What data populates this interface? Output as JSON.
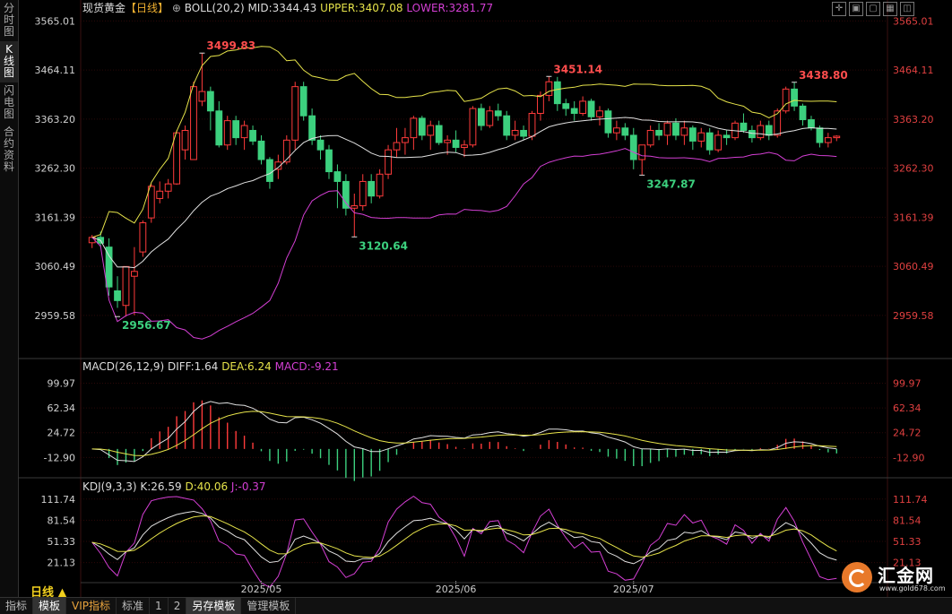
{
  "side_tabs": [
    "分时图",
    "K线图",
    "闪电图",
    "合约资料"
  ],
  "main": {
    "symbol": "现货黄金",
    "period": "【日线】",
    "plus": "⊕",
    "indicator": "BOLL(20,2)",
    "mid": "MID:3344.43",
    "upper": "UPPER:3407.08",
    "lower": "LOWER:3281.77"
  },
  "macd_header": {
    "name": "MACD(26,12,9)",
    "diff": "DIFF:1.64",
    "dea": "DEA:6.24",
    "macd": "MACD:-9.21"
  },
  "kdj_header": {
    "name": "KDJ(9,3,3)",
    "k": "K:26.59",
    "d": "D:40.06",
    "j": "J:-0.37"
  },
  "annotations": [
    "3499.83",
    "3451.14",
    "3438.80",
    "2956.67",
    "3120.64",
    "3247.87"
  ],
  "period_label": "日线 ▲",
  "bottom_tabs": [
    "指标",
    "模板",
    "VIP指标",
    "标准",
    "1",
    "2",
    "另存模板",
    "管理模板"
  ],
  "logo": {
    "text": "汇金网",
    "url": "www.gold678.com"
  },
  "window_icons": [
    "crosshair-icon",
    "zoom-in-icon",
    "zoom-out-icon",
    "grid-icon",
    "restore-icon"
  ],
  "colors": {
    "up": "#ff3b3b",
    "down": "#3cd07e",
    "mid": "#e0e0e0",
    "upper": "#e6e34a",
    "lower": "#d43fd4",
    "macd_diff": "#e0e0e0",
    "macd_dea": "#e6e34a",
    "kdj_k": "#e0e0e0",
    "kdj_d": "#e6e34a",
    "kdj_j": "#d43fd4",
    "ann_high": "#ff4d4d",
    "ann_low": "#3cd07e"
  },
  "chart_data": [
    {
      "type": "candlestick",
      "title": "现货黄金 日线",
      "x_ticks": [
        "2025/05",
        "2025/06",
        "2025/07"
      ],
      "y_ticks": [
        "3565.01",
        "3464.11",
        "3363.20",
        "3262.30",
        "3161.39",
        "3060.49",
        "2959.58"
      ],
      "ylim": [
        2880,
        3575
      ],
      "candles": [
        [
          3109,
          3125,
          3098,
          3120
        ],
        [
          3120,
          3132,
          3100,
          3108
        ],
        [
          3100,
          3118,
          3000,
          3018
        ],
        [
          3010,
          3040,
          2975,
          2990
        ],
        [
          2980,
          3060,
          2957,
          3060
        ],
        [
          3040,
          3100,
          2960,
          3050
        ],
        [
          3090,
          3155,
          3080,
          3150
        ],
        [
          3160,
          3230,
          3150,
          3225
        ],
        [
          3200,
          3235,
          3190,
          3215
        ],
        [
          3215,
          3240,
          3200,
          3230
        ],
        [
          3230,
          3340,
          3228,
          3335
        ],
        [
          3300,
          3350,
          3280,
          3340
        ],
        [
          3280,
          3440,
          3280,
          3430
        ],
        [
          3400,
          3499,
          3390,
          3420
        ],
        [
          3420,
          3430,
          3340,
          3380
        ],
        [
          3380,
          3400,
          3305,
          3310
        ],
        [
          3310,
          3370,
          3300,
          3360
        ],
        [
          3360,
          3370,
          3310,
          3325
        ],
        [
          3325,
          3360,
          3300,
          3350
        ],
        [
          3340,
          3350,
          3310,
          3318
        ],
        [
          3318,
          3330,
          3270,
          3280
        ],
        [
          3280,
          3285,
          3220,
          3235
        ],
        [
          3260,
          3290,
          3240,
          3275
        ],
        [
          3275,
          3330,
          3270,
          3320
        ],
        [
          3320,
          3440,
          3300,
          3430
        ],
        [
          3430,
          3440,
          3360,
          3370
        ],
        [
          3370,
          3385,
          3310,
          3320
        ],
        [
          3320,
          3330,
          3280,
          3300
        ],
        [
          3300,
          3310,
          3240,
          3255
        ],
        [
          3255,
          3270,
          3180,
          3235
        ],
        [
          3235,
          3250,
          3165,
          3180
        ],
        [
          3180,
          3210,
          3121,
          3185
        ],
        [
          3185,
          3250,
          3175,
          3235
        ],
        [
          3235,
          3250,
          3190,
          3205
        ],
        [
          3205,
          3260,
          3200,
          3250
        ],
        [
          3250,
          3310,
          3240,
          3300
        ],
        [
          3300,
          3345,
          3285,
          3315
        ],
        [
          3315,
          3345,
          3290,
          3325
        ],
        [
          3325,
          3370,
          3300,
          3365
        ],
        [
          3365,
          3370,
          3320,
          3330
        ],
        [
          3330,
          3360,
          3300,
          3350
        ],
        [
          3350,
          3360,
          3310,
          3315
        ],
        [
          3315,
          3330,
          3290,
          3320
        ],
        [
          3320,
          3340,
          3295,
          3305
        ],
        [
          3305,
          3320,
          3285,
          3310
        ],
        [
          3310,
          3390,
          3305,
          3385
        ],
        [
          3385,
          3395,
          3340,
          3350
        ],
        [
          3350,
          3390,
          3345,
          3380
        ],
        [
          3380,
          3395,
          3360,
          3370
        ],
        [
          3370,
          3380,
          3320,
          3330
        ],
        [
          3330,
          3360,
          3320,
          3340
        ],
        [
          3340,
          3350,
          3320,
          3328
        ],
        [
          3328,
          3380,
          3320,
          3375
        ],
        [
          3375,
          3420,
          3360,
          3412
        ],
        [
          3412,
          3451,
          3400,
          3440
        ],
        [
          3440,
          3450,
          3380,
          3395
        ],
        [
          3395,
          3405,
          3370,
          3385
        ],
        [
          3385,
          3400,
          3360,
          3375
        ],
        [
          3375,
          3410,
          3370,
          3400
        ],
        [
          3400,
          3405,
          3360,
          3368
        ],
        [
          3368,
          3390,
          3350,
          3380
        ],
        [
          3380,
          3385,
          3325,
          3335
        ],
        [
          3335,
          3360,
          3320,
          3345
        ],
        [
          3345,
          3355,
          3320,
          3330
        ],
        [
          3330,
          3345,
          3260,
          3280
        ],
        [
          3280,
          3300,
          3248,
          3310
        ],
        [
          3310,
          3350,
          3305,
          3340
        ],
        [
          3340,
          3355,
          3320,
          3330
        ],
        [
          3330,
          3360,
          3310,
          3355
        ],
        [
          3355,
          3365,
          3320,
          3330
        ],
        [
          3330,
          3360,
          3310,
          3345
        ],
        [
          3345,
          3350,
          3300,
          3318
        ],
        [
          3318,
          3345,
          3305,
          3335
        ],
        [
          3335,
          3345,
          3290,
          3300
        ],
        [
          3300,
          3340,
          3295,
          3330
        ],
        [
          3330,
          3340,
          3310,
          3325
        ],
        [
          3325,
          3360,
          3320,
          3355
        ],
        [
          3355,
          3375,
          3335,
          3340
        ],
        [
          3340,
          3350,
          3315,
          3325
        ],
        [
          3325,
          3360,
          3320,
          3350
        ],
        [
          3350,
          3360,
          3320,
          3330
        ],
        [
          3330,
          3385,
          3325,
          3380
        ],
        [
          3380,
          3430,
          3375,
          3425
        ],
        [
          3425,
          3439,
          3380,
          3390
        ],
        [
          3390,
          3395,
          3350,
          3362
        ],
        [
          3362,
          3370,
          3340,
          3345
        ],
        [
          3345,
          3350,
          3305,
          3315
        ],
        [
          3315,
          3335,
          3305,
          3325
        ],
        [
          3325,
          3330,
          3318,
          3328
        ]
      ]
    },
    {
      "type": "bar+line",
      "name": "MACD",
      "y_ticks": [
        "99.97",
        "62.34",
        "24.72",
        "-12.90"
      ],
      "ylim": [
        -37,
        113
      ]
    },
    {
      "type": "line",
      "name": "KDJ",
      "y_ticks": [
        "111.74",
        "81.54",
        "51.33",
        "21.13"
      ],
      "ylim": [
        -5,
        123
      ]
    }
  ]
}
